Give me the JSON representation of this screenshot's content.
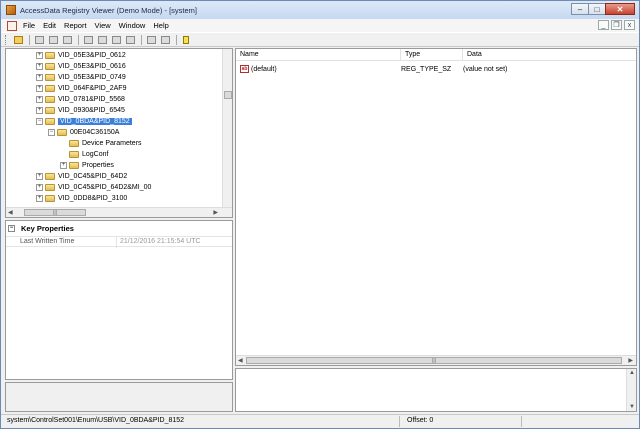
{
  "window": {
    "title": "AccessData Registry Viewer (Demo Mode) - [system]",
    "minimize": "–",
    "maximize": "□",
    "close": "✕"
  },
  "menu": {
    "items": [
      "File",
      "Edit",
      "Report",
      "View",
      "Window",
      "Help"
    ],
    "mdi_minimize": "_",
    "mdi_restore": "❐",
    "mdi_close": "x"
  },
  "toolbar": {
    "icons": [
      "open-icon",
      "report-icon",
      "find-icon",
      "copy-icon",
      "nav-back-icon",
      "nav-forward-icon",
      "export-icon",
      "import-icon",
      "tile-icon",
      "cascade-icon",
      "help-icon"
    ]
  },
  "tree": {
    "nodes": [
      {
        "label": "VID_05E3&PID_0612",
        "expander": "+",
        "selected": false
      },
      {
        "label": "VID_05E3&PID_0616",
        "expander": "+",
        "selected": false
      },
      {
        "label": "VID_05E3&PID_0749",
        "expander": "+",
        "selected": false
      },
      {
        "label": "VID_064F&PID_2AF9",
        "expander": "+",
        "selected": false
      },
      {
        "label": "VID_0781&PID_5568",
        "expander": "+",
        "selected": false
      },
      {
        "label": "VID_0930&PID_6545",
        "expander": "+",
        "selected": false
      },
      {
        "label": "VID_0BDA&PID_8152",
        "expander": "−",
        "selected": true
      },
      {
        "label": "00E04C36150A",
        "expander": "−",
        "selected": false
      },
      {
        "label": "Device Parameters",
        "expander": "",
        "selected": false
      },
      {
        "label": "LogConf",
        "expander": "",
        "selected": false
      },
      {
        "label": "Properties",
        "expander": "+",
        "selected": false
      },
      {
        "label": "VID_0C45&PID_64D2",
        "expander": "+",
        "selected": false
      },
      {
        "label": "VID_0C45&PID_64D2&MI_00",
        "expander": "+",
        "selected": false
      },
      {
        "label": "VID_0DD8&PID_3100",
        "expander": "+",
        "selected": false
      }
    ],
    "hscroll_grip": "|||"
  },
  "key_properties": {
    "header": "Key Properties",
    "collapse": "−",
    "rows": [
      {
        "name": "Last Written Time",
        "value": "21/12/2016 21:15:54 UTC"
      }
    ]
  },
  "values": {
    "columns": [
      "Name",
      "Type",
      "Data"
    ],
    "rows": [
      {
        "name": "(default)",
        "type": "REG_TYPE_SZ",
        "data": "(value not set)",
        "icon": "ab"
      }
    ],
    "hscroll_grip": "|||"
  },
  "status": {
    "path": "system\\ControlSet001\\Enum\\USB\\VID_0BDA&PID_8152",
    "offset": "Offset: 0"
  }
}
